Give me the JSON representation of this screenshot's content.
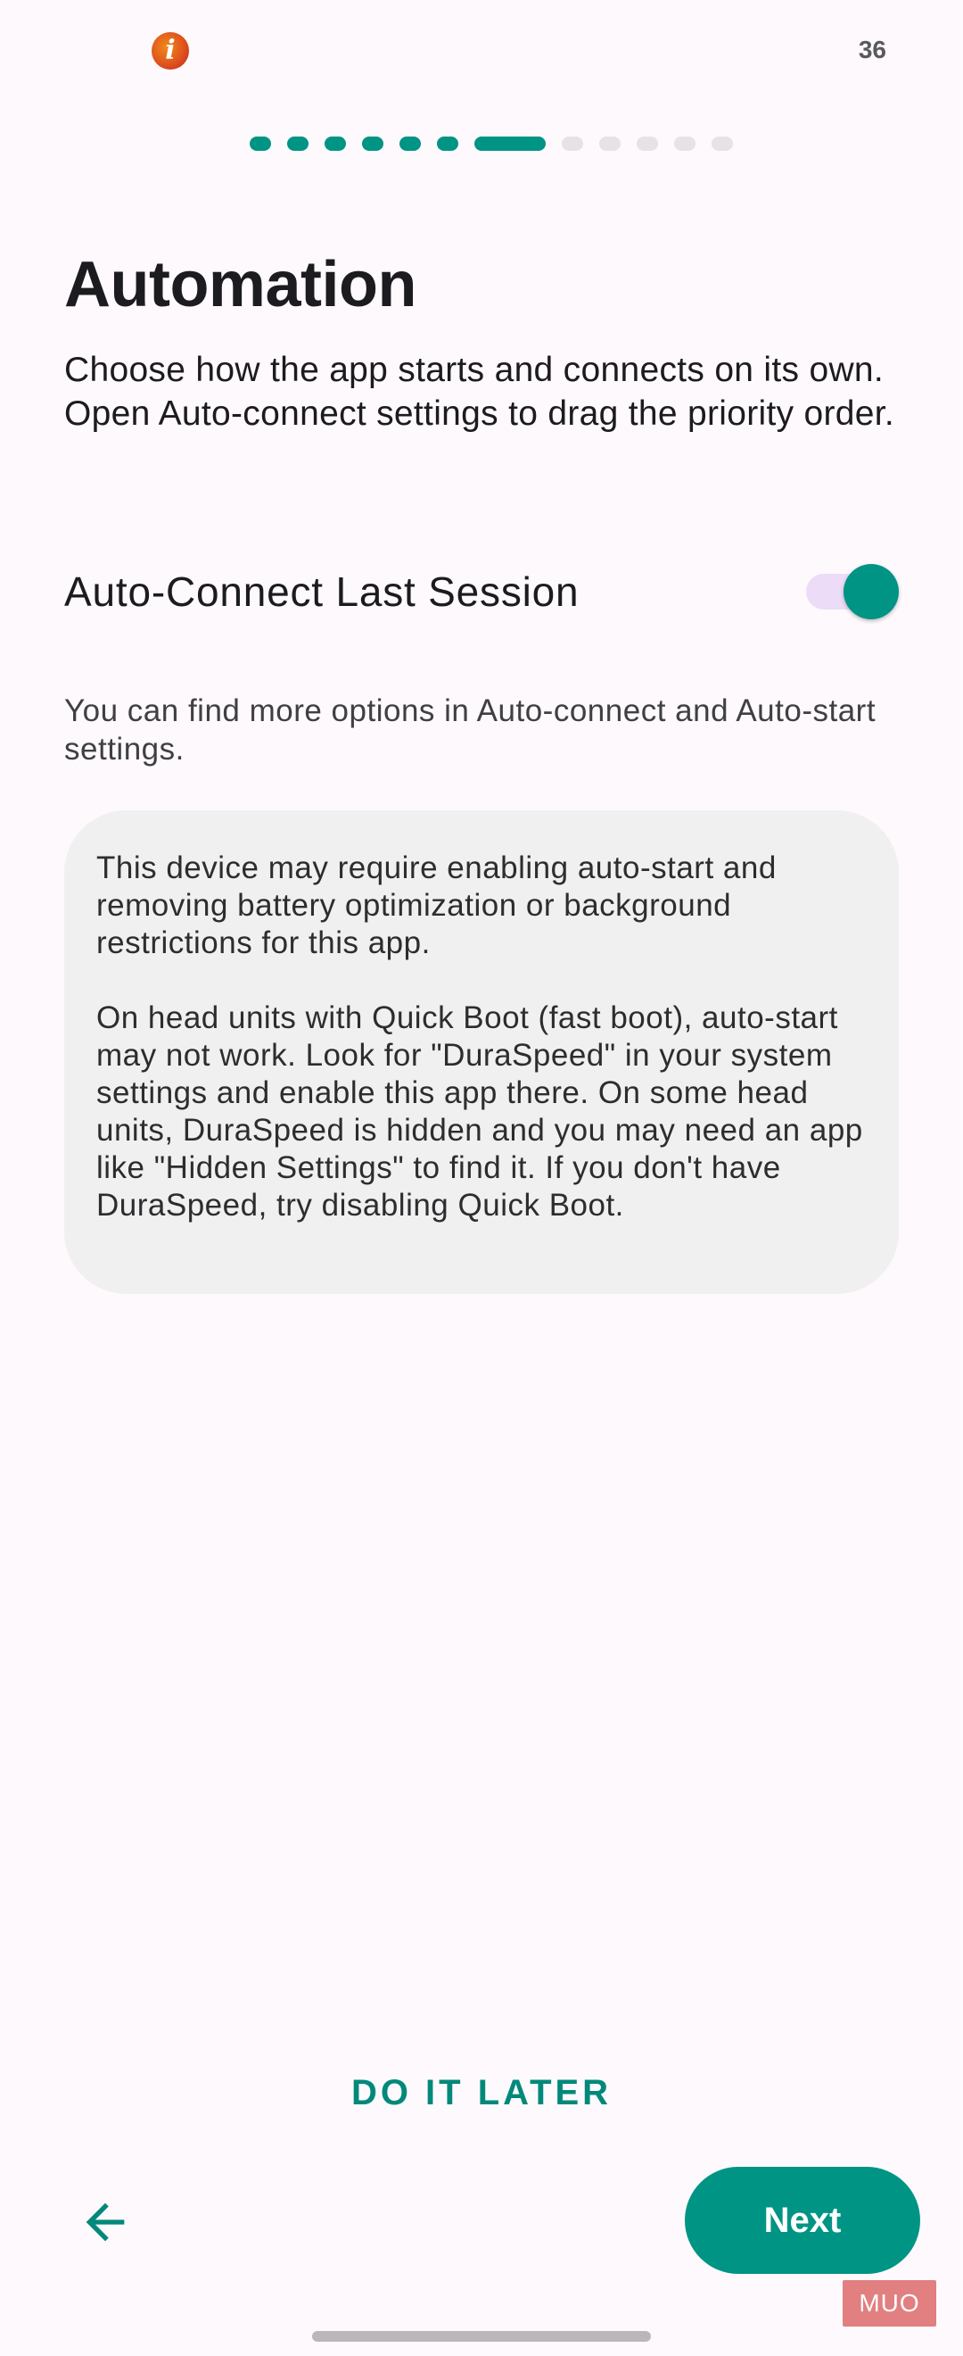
{
  "status_bar": {
    "battery_text": "36",
    "logo_letter": "i"
  },
  "progress": {
    "total_steps": 12,
    "current_step": 7
  },
  "screen": {
    "title": "Automation",
    "intro": "Choose how the app starts and connects on its own. Open Auto-connect settings to drag the priority order.",
    "toggle": {
      "label": "Auto-Connect Last Session",
      "enabled": true
    },
    "hint": "You can find more options in Auto-connect and Auto-start settings.",
    "info_card": {
      "paragraph_1": "This device may require enabling auto-start and removing battery optimization or background restrictions for this app.",
      "paragraph_2": "On head units with Quick Boot (fast boot), auto-start may not work. Look for \"DuraSpeed\" in your system settings and enable this app there. On some head units, DuraSpeed is hidden and you may need an app like \"Hidden Settings\" to find it. If you don't have DuraSpeed, try disabling Quick Boot."
    }
  },
  "actions": {
    "later_label": "DO IT LATER",
    "next_label": "Next",
    "back_icon": "arrow-left-icon"
  },
  "watermark": "MUO",
  "colors": {
    "accent": "#009485",
    "background": "#fdf9fc",
    "card": "#eff0ef",
    "toggle_track": "#ecdcf7"
  }
}
